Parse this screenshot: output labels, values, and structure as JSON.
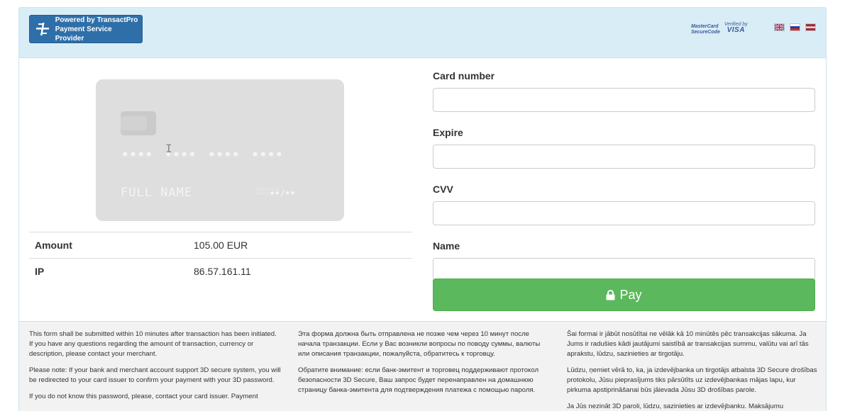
{
  "header": {
    "brand": {
      "line1": "Powered by TransactPro",
      "line2": "Payment Service Provider",
      "icon": "transactpro-logo-icon"
    },
    "security_logos": {
      "mastercard_line1": "MasterCard",
      "mastercard_line2": "SecureCode",
      "visa_line1": "Verified by",
      "visa_line2": "VISA"
    },
    "languages": [
      {
        "code": "en",
        "icon": "uk-flag-icon"
      },
      {
        "code": "ru",
        "icon": "ru-flag-icon"
      },
      {
        "code": "lv",
        "icon": "lv-flag-icon"
      }
    ]
  },
  "card_preview": {
    "number": "•••• •••• •••• ••••",
    "name": "FULL NAME",
    "exp_label_line1": "MONTH/YEAR",
    "exp_label_line2": "VALID THRU",
    "exp_value": "••/••"
  },
  "info": [
    {
      "label": "Amount",
      "value": "105.00 EUR"
    },
    {
      "label": "IP",
      "value": "86.57.161.11"
    }
  ],
  "form": {
    "card_number": {
      "label": "Card number",
      "value": "",
      "placeholder": ""
    },
    "expire": {
      "label": "Expire",
      "value": "",
      "placeholder": ""
    },
    "cvv": {
      "label": "CVV",
      "value": "",
      "placeholder": ""
    },
    "name": {
      "label": "Name",
      "value": "",
      "placeholder": ""
    },
    "pay_label": "Pay",
    "pay_icon": "lock-icon"
  },
  "footer": {
    "en": [
      "This form shall be submitted within 10 minutes after transaction has been initiated. If you have any questions regarding the amount of transaction, currency or description, please contact your merchant.",
      "Please note: If your bank and merchant account support 3D secure system, you will be redirected to your card issuer to confirm your payment with your 3D password.",
      "If you do not know this password, please, contact your card issuer. Payment"
    ],
    "ru": [
      "Эта форма должна быть отправлена не позже чем через 10 минут после начала транзакции. Если у Вас возникли вопросы по поводу суммы, валюты или описания транзакции, пожалуйста, обратитесь к торговцу.",
      "Обратите внимание: если банк-эмитент и торговец поддерживают протокол безопасности 3D Secure, Ваш запрос будет перенаправлен на домашнюю страницу банка-эмитента для подтверждения платежа с помощью пароля."
    ],
    "lv": [
      "Šai formai ir jābūt nosūtītai ne vēlāk kā 10 minūtēs pēc transakcijas sākuma. Ja Jums ir radušies kādi jautājumi saistībā ar transakcijas summu, valūtu vai arī tās aprakstu, lūdzu, sazinieties ar tirgotāju.",
      "Lūdzu, ņemiet vērā to, ka, ja izdevējbanka un tirgotājs atbalsta 3D Secure drošības protokolu, Jūsu pieprasījums tiks pārsūtīts uz izdevējbankas mājas lapu, kur pirkuma apstiprināšanai būs jāievada Jūsu 3D drošības parole.",
      "Ja Jūs nezināt 3D paroli, lūdzu, sazinieties ar izdevējbanku. Maksājumu"
    ]
  }
}
